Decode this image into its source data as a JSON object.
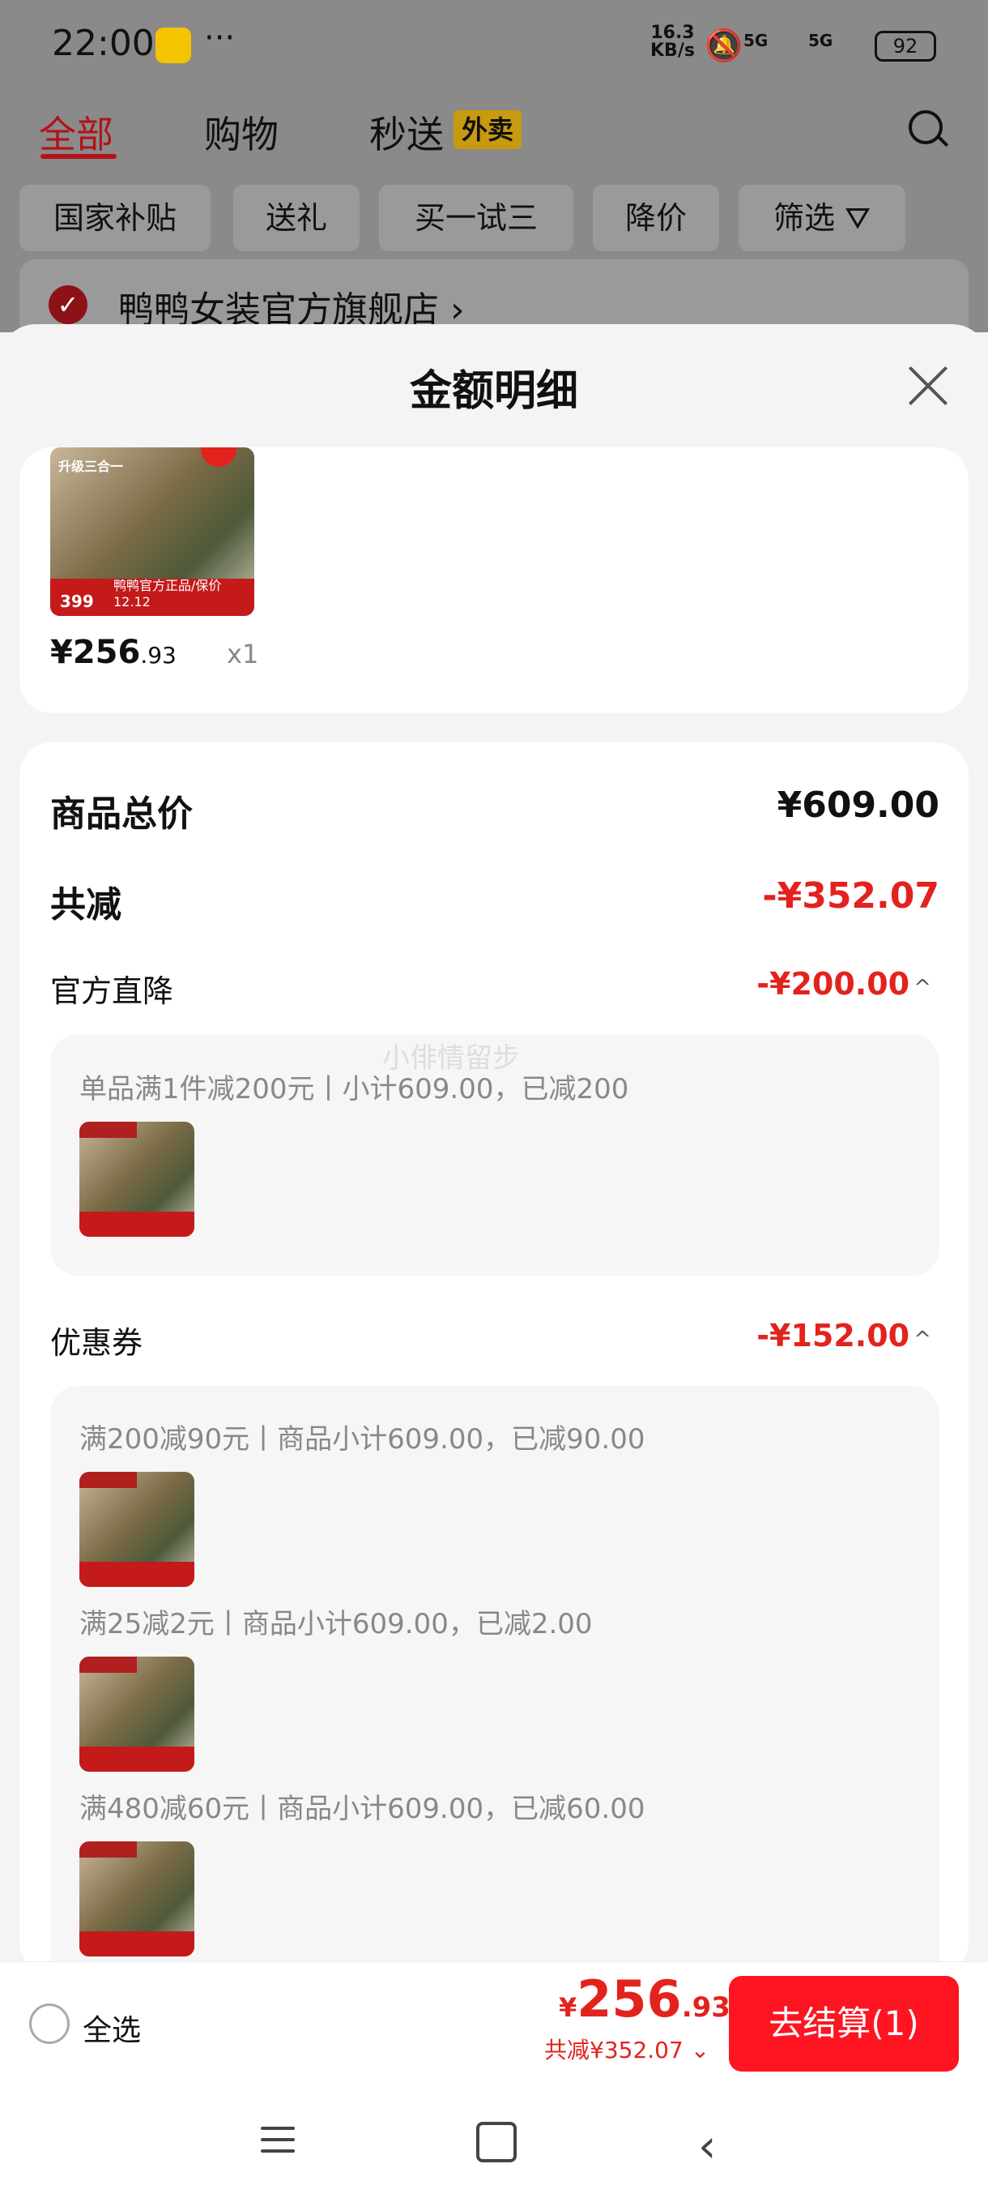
{
  "status_bar": {
    "time": "22:00",
    "more": "···",
    "net_speed_top": "16.3",
    "net_speed_bottom": "KB/s",
    "sig1": "5G",
    "sig2": "5G",
    "battery": "92"
  },
  "tabs": [
    {
      "label": "全部"
    },
    {
      "label": "购物"
    },
    {
      "label": "秒送"
    }
  ],
  "tab_badge": "外卖",
  "filters": [
    {
      "label": "国家补贴"
    },
    {
      "label": "送礼"
    },
    {
      "label": "买一试三"
    },
    {
      "label": "降价"
    },
    {
      "label": "筛选"
    }
  ],
  "store": {
    "name": "鸭鸭女装官方旗舰店",
    "chevron": "›"
  },
  "sheet": {
    "title": "金额明细",
    "product": {
      "price_int": "¥256",
      "price_dec": ".93",
      "qty": "x1",
      "thumb_texts": [
        "升级三合一",
        "399",
        "鸭鸭官方正品/保价12.12"
      ]
    },
    "summary": {
      "total_label": "商品总价",
      "total_value": "¥609.00",
      "reduce_label": "共减",
      "reduce_value": "-¥352.07"
    },
    "official": {
      "label": "官方直降",
      "value": "-¥200.00",
      "chevron": "^",
      "desc": "单品满1件减200元丨小计609.00，已减200",
      "watermark": "小俳情留步"
    },
    "coupon": {
      "label": "优惠券",
      "value": "-¥152.00",
      "chevron": "^",
      "items": [
        {
          "desc": "满200减90元丨商品小计609.00，已减90.00"
        },
        {
          "desc": "满25减2元丨商品小计609.00，已减2.00"
        },
        {
          "desc": "满480减60元丨商品小计609.00，已减60.00"
        }
      ]
    }
  },
  "bottom_bar": {
    "select_all": "全选",
    "yen": "¥",
    "amount_int": "256",
    "amount_dec": ".93",
    "saved": "共减¥352.07 ⌄",
    "checkout": "去结算(1)"
  },
  "colors": {
    "accent_red": "#e3221e",
    "checkout_red": "#ff1422",
    "tab_red": "#b3121a"
  }
}
